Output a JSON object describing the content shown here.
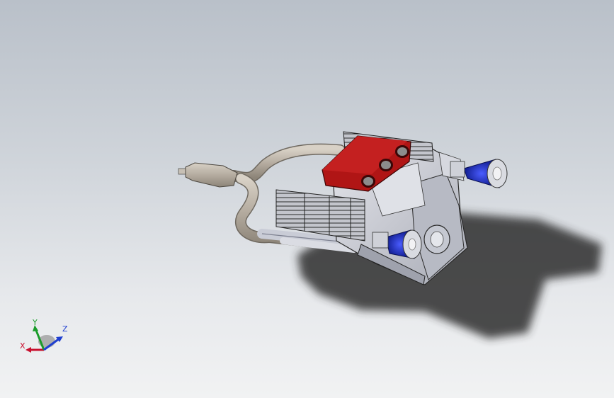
{
  "viewport": {
    "kind": "3D CAD model view"
  },
  "model": {
    "parts": [
      "exhaust-pipe",
      "muffler",
      "engine-block",
      "valve-cover",
      "intake-manifold",
      "air-filter-top",
      "air-filter-bottom",
      "pulley"
    ],
    "colors": {
      "valve_cover": "#b01515",
      "exhaust": "#b5aca0",
      "block": "#c9cbd3",
      "air_filter": "#1c2fc8",
      "shadow": "#3a3a3a"
    }
  },
  "triad": {
    "x_label": "X",
    "y_label": "Y",
    "z_label": "Z",
    "colors": {
      "x": "#c8102e",
      "y": "#1a9c2a",
      "z": "#1f3fd0"
    }
  }
}
